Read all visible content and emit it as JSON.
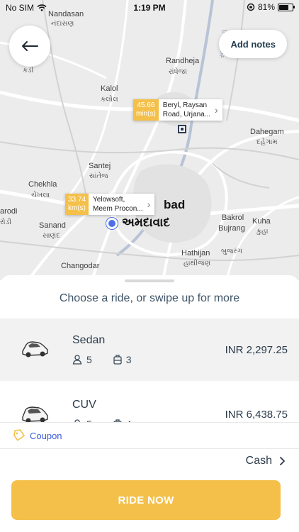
{
  "status_bar": {
    "carrier": "No SIM",
    "time": "1:19 PM",
    "battery": "81%",
    "battery_level": 0.81
  },
  "map": {
    "labels": {
      "nandasan": "Nandasan",
      "nandasan_gu": "નંદાસણ",
      "kadi_gu": "કડી",
      "randheja": "Randheja",
      "randheja_gu": "રાંધેજા",
      "kalol": "Kalol",
      "kalol_gu": "કલોલ",
      "dahegam": "Dahegam",
      "dahegam_gu": "દહેગામ",
      "santej": "Santej",
      "santej_gu": "સાંતેજ",
      "chekhla": "Chekhla",
      "chekhla_gu": "ચેખલા",
      "virodi": "arodi",
      "virodi_gu": "રોડી",
      "sanand": "Sanand",
      "sanand_gu": "સાણંદ",
      "ahmedabad": "bad",
      "ahmedabad_gu": "અમદાવાદ",
      "bakrol": "Bakrol",
      "bakrol_gu": "બાકરોલ",
      "bujrang": "Bujrang",
      "bujrang_gu": "બુજરંગ",
      "kuha": "Kuha",
      "kuha_gu": "કુહા",
      "hathijan": "Hathijan",
      "hathijan_gu": "હાથીજણ",
      "changodar": "Changodar",
      "sabarmati_gu": "સાબરમતી"
    },
    "pickup": {
      "eta_value": "33.74",
      "eta_unit": "km(s)",
      "address_line1": "Yelowsoft,",
      "address_line2": "Meem Procon..."
    },
    "dropoff": {
      "eta_value": "45.66",
      "eta_unit": "min(s)",
      "address_line1": "Beryl, Raysan",
      "address_line2": "Road, Urjana..."
    }
  },
  "header": {
    "add_notes": "Add notes"
  },
  "sheet": {
    "title": "Choose a ride, or swipe up for more",
    "rides": [
      {
        "name": "Sedan",
        "passengers": "5",
        "luggage": "3",
        "price": "INR 2,297.25",
        "selected": true
      },
      {
        "name": "CUV",
        "passengers": "5",
        "luggage": "4",
        "price": "INR 6,438.75",
        "selected": false
      }
    ],
    "coupon": "Coupon",
    "payment": "Cash",
    "cta": "RIDE NOW"
  },
  "colors": {
    "accent": "#f4c04a",
    "coupon_blue": "#3a5bd9",
    "pin_blue": "#4e6fe8",
    "text_dark": "#2b3b4a"
  }
}
